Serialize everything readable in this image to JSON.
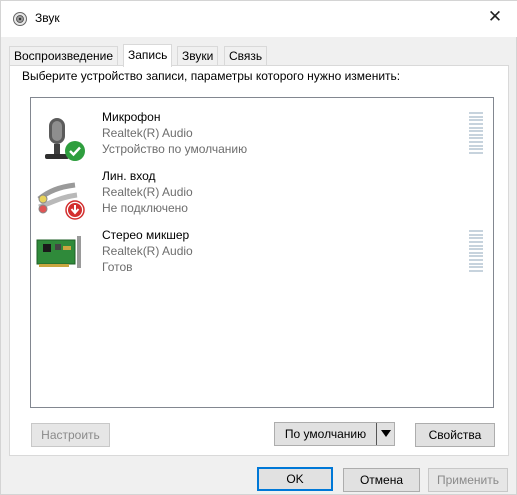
{
  "window": {
    "title": "Звук",
    "close_symbol": "✕"
  },
  "tabs": [
    {
      "label": "Воспроизведение",
      "active": false
    },
    {
      "label": "Запись",
      "active": true
    },
    {
      "label": "Звуки",
      "active": false
    },
    {
      "label": "Связь",
      "active": false
    }
  ],
  "instruction": "Выберите устройство записи, параметры которого нужно изменить:",
  "devices": [
    {
      "name": "Микрофон",
      "driver": "Realtek(R) Audio",
      "status": "Устройство по умолчанию",
      "icon": "microphone-icon",
      "badge": "default-check-icon",
      "meter": true
    },
    {
      "name": "Лин. вход",
      "driver": "Realtek(R) Audio",
      "status": "Не подключено",
      "icon": "line-in-cable-icon",
      "badge": "disconnected-arrow-icon",
      "meter": false
    },
    {
      "name": "Стерео микшер",
      "driver": "Realtek(R) Audio",
      "status": "Готов",
      "icon": "sound-card-icon",
      "badge": null,
      "meter": true
    }
  ],
  "buttons": {
    "configure": "Настроить",
    "set_default": "По умолчанию",
    "properties": "Свойства",
    "ok": "OK",
    "cancel": "Отмена",
    "apply": "Применить"
  },
  "colors": {
    "accent": "#0078d7",
    "check": "#2e9e3e",
    "warning": "#d32f2f"
  }
}
